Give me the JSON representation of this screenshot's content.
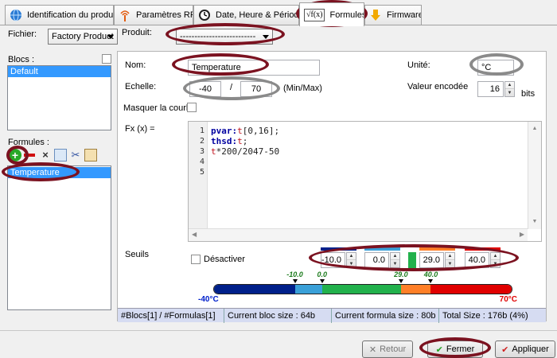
{
  "tabs": [
    {
      "label": "Identification du produit",
      "icon": "globe-icon"
    },
    {
      "label": "Paramètres RF",
      "icon": "antenna-icon"
    },
    {
      "label": "Date, Heure & Période",
      "icon": "clock-icon"
    },
    {
      "label": "Formules",
      "icon": "sqrt-fx-icon",
      "icon_text": "√f(x)"
    },
    {
      "label": "Firmware",
      "icon": "download-arrow-icon"
    }
  ],
  "fichier": {
    "label": "Fichier:",
    "value": "Factory Product"
  },
  "produit": {
    "label": "Produit:",
    "value": "--------------------------"
  },
  "blocs": {
    "label": "Blocs :",
    "items": [
      "Default"
    ]
  },
  "formules": {
    "label": "Formules :",
    "items": [
      "Temperature"
    ]
  },
  "form": {
    "nom_label": "Nom:",
    "nom_value": "Temperature",
    "unite_label": "Unité:",
    "unite_value": "°C",
    "echelle_label": "Echelle:",
    "min": "-40",
    "sep": "/",
    "max": "70",
    "minmax": "(Min/Max)",
    "valeur_label": "Valeur encodée",
    "valeur_value": "16",
    "bits": "bits",
    "masquer_label": "Masquer la courbe",
    "fx_label": "Fx (x) ="
  },
  "code": {
    "line_numbers": [
      "1",
      "2",
      "3",
      "4",
      "5"
    ],
    "lines": [
      [
        {
          "t": "pvar:",
          "c": "kw"
        },
        {
          "t": "t",
          "c": "var"
        },
        {
          "t": "[0,16];",
          "c": "plain"
        }
      ],
      [
        {
          "t": "thsd:",
          "c": "kw"
        },
        {
          "t": "t",
          "c": "var"
        },
        {
          "t": ";",
          "c": "plain"
        }
      ],
      [
        {
          "t": "t",
          "c": "var"
        },
        {
          "t": "*200/2047-50",
          "c": "plain"
        }
      ],
      [],
      []
    ]
  },
  "seuils": {
    "label": "Seuils",
    "desactiver": "Désactiver",
    "values": [
      "-10.0",
      "0.0",
      "29.0",
      "40.0"
    ],
    "scale_min": "-40°C",
    "scale_max": "70°C",
    "markers": [
      "-10.0",
      "0.0",
      "29.0",
      "40.0"
    ],
    "range": [
      -40,
      70
    ],
    "colors": {
      "blue": "#00208a",
      "cyan": "#3aa0d8",
      "green": "#22b14c",
      "orange": "#ff7f27",
      "red": "#e00000"
    }
  },
  "status": [
    "#Blocs[1] / #Formulas[1]",
    "Current bloc size : 64b",
    "Current formula size : 80b",
    "Total Size : 176b (4%)"
  ],
  "buttons": {
    "cancel": "Retour",
    "ok": "Fermer",
    "apply": "Appliquer"
  }
}
